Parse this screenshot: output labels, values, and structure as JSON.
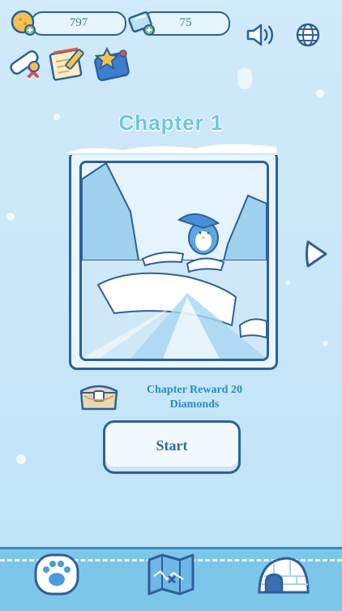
{
  "resources": {
    "coins": "797",
    "diamonds": "75"
  },
  "top_icons": [
    "certificate-icon",
    "notepad-icon",
    "star-book-icon"
  ],
  "settings_icons": [
    "sound-icon",
    "globe-icon"
  ],
  "chapter": {
    "title": "Chapter 1",
    "reward_line1": "Chapter Reward 20",
    "reward_line2": "Diamonds",
    "start_label": "Start"
  },
  "bottom_tabs": [
    "paw-icon",
    "map-icon",
    "igloo-icon"
  ],
  "colors": {
    "outline": "#2e5f9b",
    "sky": "#cfeaf9",
    "accent": "#6fc5e8",
    "bar": "#7cc6ea"
  }
}
